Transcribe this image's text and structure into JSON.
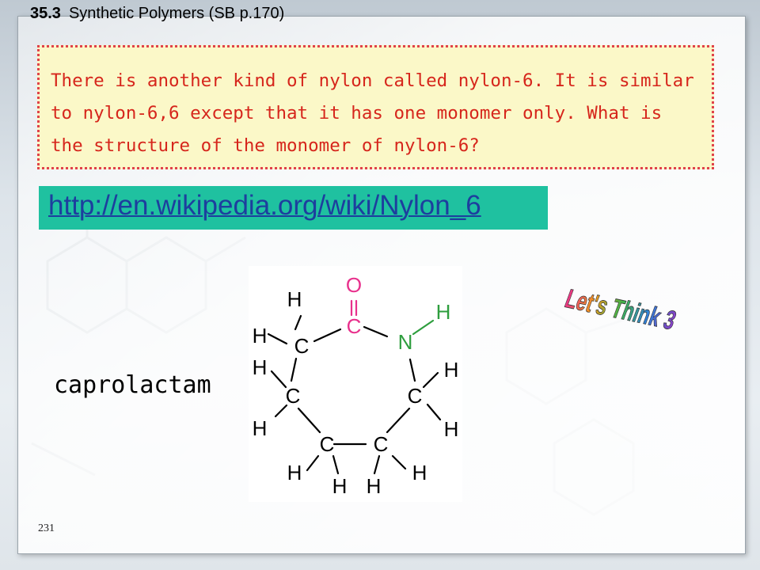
{
  "header": {
    "section_number": "35.3",
    "section_title": "Synthetic Polymers (SB p.170)"
  },
  "question": {
    "text": "There is another kind of nylon called nylon-6. It is similar to nylon-6,6 except that it has one monomer only. What is the structure of the monomer of nylon-6?"
  },
  "link": {
    "text": "http://en.wikipedia.org/wiki/Nylon_6"
  },
  "molecule": {
    "name": "caprolactam",
    "atoms": {
      "oxygen": "O",
      "nitrogen": "N",
      "carbon": "C",
      "hydrogen": "H"
    }
  },
  "sticker": {
    "text": "Let's Think 3"
  },
  "footer": {
    "page_number": "231"
  },
  "colors": {
    "question_text": "#d6261c",
    "question_bg": "#fbf8c8",
    "question_border": "#e0424a",
    "link_bg": "#1fc1a0",
    "link_text": "#1d3e9e",
    "oxygen": "#e8308c",
    "nitrogen_and_nh": "#2e9e3e"
  }
}
